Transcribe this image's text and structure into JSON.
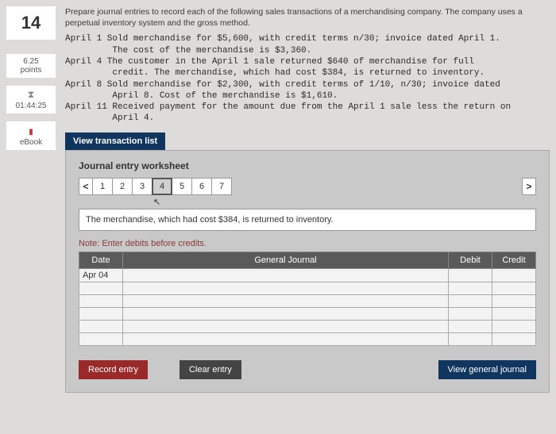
{
  "question_number": "14",
  "points_value": "6.25",
  "points_label": "points",
  "timer": "01:44:25",
  "ebook_label": "eBook",
  "intro": "Prepare journal entries to record each of the following sales transactions of a merchandising company. The company uses a perpetual inventory system and the gross method.",
  "transactions": "April 1 Sold merchandise for $5,600, with credit terms n/30; invoice dated April 1.\n         The cost of the merchandise is $3,360.\nApril 4 The customer in the April 1 sale returned $640 of merchandise for full\n         credit. The merchandise, which had cost $384, is returned to inventory.\nApril 8 Sold merchandise for $2,300, with credit terms of 1/10, n/30; invoice dated\n         April 8. Cost of the merchandise is $1,610.\nApril 11 Received payment for the amount due from the April 1 sale less the return on\n         April 4.",
  "tab_label": "View transaction list",
  "worksheet": {
    "title": "Journal entry worksheet",
    "nav_prev": "<",
    "nav_next": ">",
    "steps": [
      "1",
      "2",
      "3",
      "4",
      "5",
      "6",
      "7"
    ],
    "active_step": 3,
    "description": "The merchandise, which had cost $384, is returned to inventory.",
    "note": "Note: Enter debits before credits.",
    "headers": {
      "date": "Date",
      "gj": "General Journal",
      "debit": "Debit",
      "credit": "Credit"
    },
    "rows": [
      {
        "date": "Apr 04",
        "gj": "",
        "debit": "",
        "credit": ""
      },
      {
        "date": "",
        "gj": "",
        "debit": "",
        "credit": ""
      },
      {
        "date": "",
        "gj": "",
        "debit": "",
        "credit": ""
      },
      {
        "date": "",
        "gj": "",
        "debit": "",
        "credit": ""
      },
      {
        "date": "",
        "gj": "",
        "debit": "",
        "credit": ""
      },
      {
        "date": "",
        "gj": "",
        "debit": "",
        "credit": ""
      }
    ],
    "buttons": {
      "record": "Record entry",
      "clear": "Clear entry",
      "view": "View general journal"
    }
  }
}
